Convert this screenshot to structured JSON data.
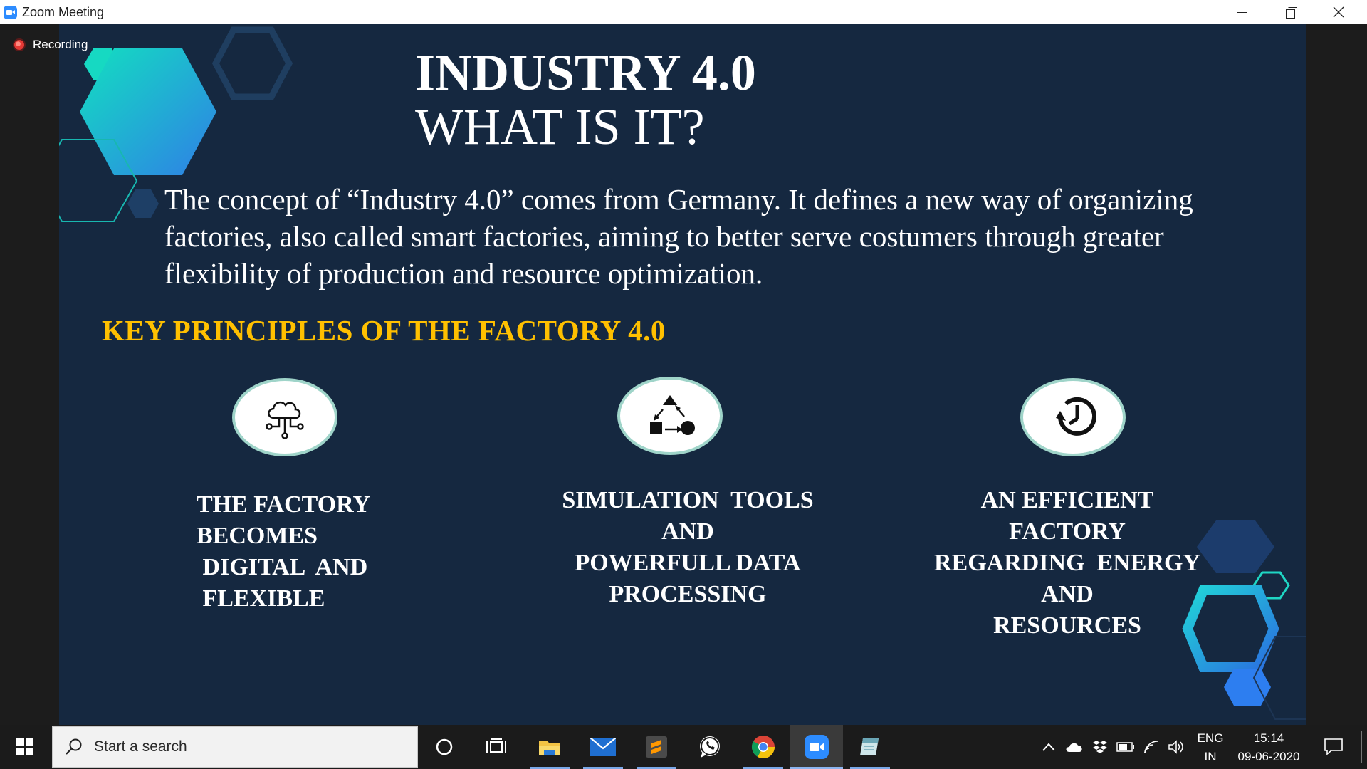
{
  "window": {
    "title": "Zoom Meeting",
    "controls": [
      "minimize",
      "restore",
      "close"
    ]
  },
  "meeting": {
    "recording_label": "Recording"
  },
  "slide": {
    "title_line1": "INDUSTRY 4.0",
    "title_line2": "WHAT IS IT?",
    "intro_line1": "The concept of “Industry 4.0” comes from Germany. It defines a new way  of organizing",
    "intro_line2": "factories, also called smart factories, aiming to better serve costumers through greater",
    "intro_line3": "flexibility  of  production and resource optimization.",
    "key_heading": "KEY PRINCIPLES  OF THE FACTORY 4.0",
    "principles": [
      {
        "icon": "cloud-network-icon",
        "text": "THE FACTORY\nBECOMES\n DIGITAL  AND\n FLEXIBLE"
      },
      {
        "icon": "shapes-flow-icon",
        "text": "SIMULATION  TOOLS\nAND\nPOWERFULL DATA\nPROCESSING"
      },
      {
        "icon": "clock-refresh-icon",
        "text": "AN EFFICIENT\nFACTORY\nREGARDING  ENERGY\nAND\nRESOURCES"
      }
    ],
    "accent_colors": {
      "background": "#152840",
      "heading": "#ffc000",
      "hex_teal": "#1fd6c4",
      "hex_blue": "#2b78e0"
    }
  },
  "taskbar": {
    "search_placeholder": "Start a search",
    "apps": [
      "cortana-icon",
      "task-view-icon",
      "file-explorer-icon",
      "mail-icon",
      "sublime-text-icon",
      "whatsapp-icon",
      "chrome-icon",
      "zoom-icon",
      "notes-app-icon"
    ],
    "tray": {
      "lang_line1": "ENG",
      "lang_line2": "IN",
      "time": "15:14",
      "date": "09-06-2020"
    }
  }
}
